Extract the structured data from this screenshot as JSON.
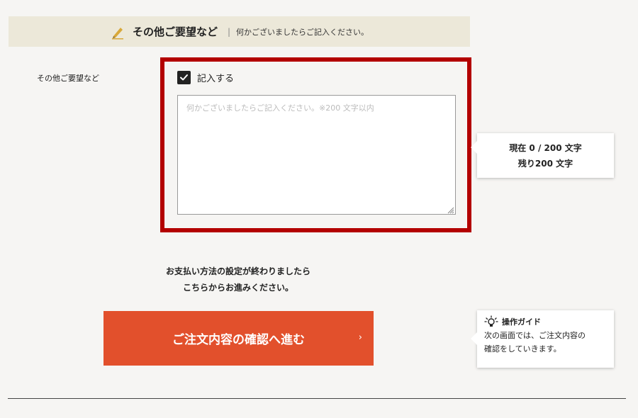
{
  "section": {
    "title": "その他ご要望など",
    "separator": "|",
    "description": "何かございましたらご記入ください。"
  },
  "form": {
    "row_label": "その他ご要望など",
    "checkbox_label": "記入する",
    "checkbox_checked": true,
    "textarea_placeholder": "何かございましたらご記入ください。※200 文字以内",
    "textarea_value": ""
  },
  "counter": {
    "current_line": "現在 0 / 200 文字",
    "remaining_line": "残り200 文字"
  },
  "notice": {
    "line1": "お支払い方法の設定が終わりましたら",
    "line2": "こちらからお進みください。"
  },
  "confirm_button": {
    "label": "ご注文内容の確認へ進む",
    "arrow": "›"
  },
  "guide": {
    "title": "操作ガイド",
    "line1": "次の画面では、ご注文内容の",
    "line2": "確認をしていきます。"
  },
  "icons": {
    "section": "pencil-icon",
    "checkbox": "check-icon",
    "guide": "lightbulb-icon"
  },
  "colors": {
    "accent": "#e2502c",
    "highlight_frame": "#b30000",
    "pencil": "#d8a83a",
    "header_bg": "#ece8d9"
  }
}
